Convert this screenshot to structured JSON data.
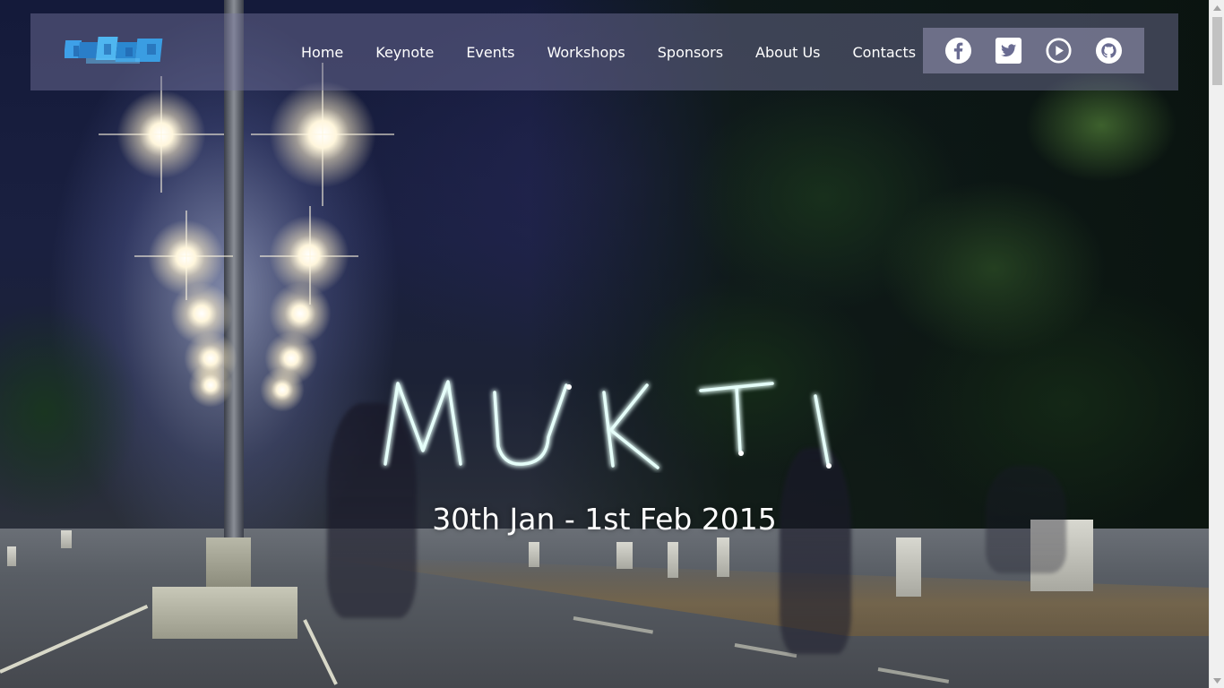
{
  "site": {
    "logo_alt": "MUKTI",
    "logo_icon": "mukti-logo"
  },
  "nav": {
    "items": [
      {
        "label": "Home"
      },
      {
        "label": "Keynote"
      },
      {
        "label": "Events"
      },
      {
        "label": "Workshops"
      },
      {
        "label": "Sponsors"
      },
      {
        "label": "About Us"
      },
      {
        "label": "Contacts"
      }
    ]
  },
  "social": {
    "items": [
      {
        "icon": "facebook-icon"
      },
      {
        "icon": "twitter-icon"
      },
      {
        "icon": "youtube-play-icon"
      },
      {
        "icon": "github-icon"
      }
    ]
  },
  "hero": {
    "title": "MUKTI",
    "date": "30th Jan - 1st Feb 2015"
  },
  "colors": {
    "nav_bg": "#787aa0",
    "text": "#ffffff",
    "logo_blue": "#2f8fd8",
    "light_painting": "#d8fff8"
  }
}
